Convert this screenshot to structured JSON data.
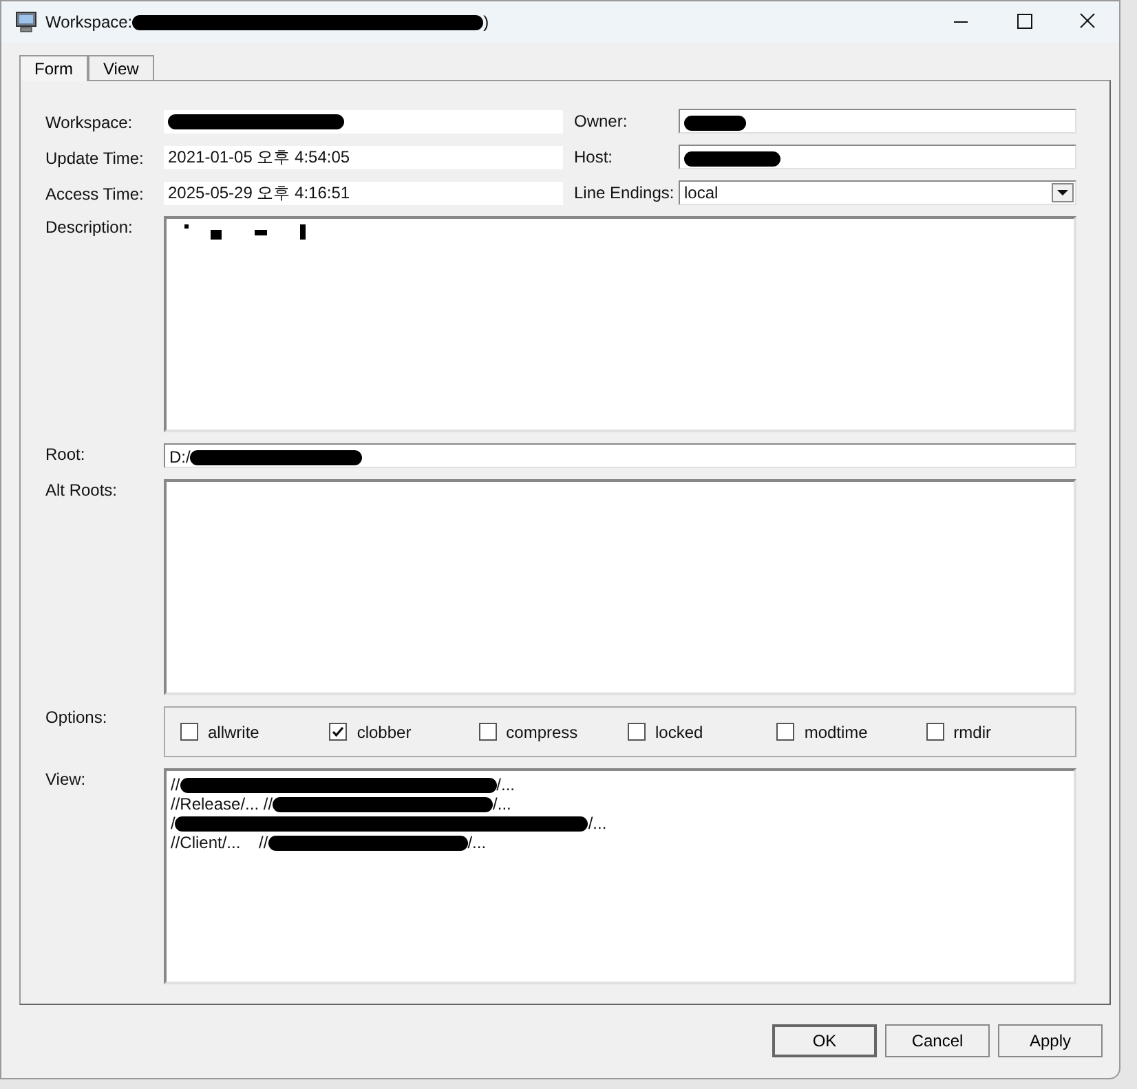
{
  "window": {
    "title": "Workspace:",
    "title_end": ")"
  },
  "tabs": [
    {
      "label": "Form",
      "selected": true
    },
    {
      "label": "View",
      "selected": false
    }
  ],
  "fields": {
    "workspace": {
      "label": "Workspace:"
    },
    "update_time": {
      "label": "Update Time:",
      "value": "2021-01-05 오후 4:54:05"
    },
    "access_time": {
      "label": "Access Time:",
      "value": "2025-05-29 오후 4:16:51"
    },
    "owner": {
      "label": "Owner:"
    },
    "host": {
      "label": "Host:"
    },
    "line_endings": {
      "label": "Line Endings:",
      "value": "local"
    },
    "description": {
      "label": "Description:"
    },
    "root": {
      "label": "Root:",
      "value": "D:/"
    },
    "alt_roots": {
      "label": "Alt Roots:"
    }
  },
  "options": {
    "label": "Options:",
    "items": [
      {
        "label": "allwrite",
        "checked": false
      },
      {
        "label": "clobber",
        "checked": true
      },
      {
        "label": "compress",
        "checked": false
      },
      {
        "label": "locked",
        "checked": false
      },
      {
        "label": "modtime",
        "checked": false
      },
      {
        "label": "rmdir",
        "checked": false
      }
    ]
  },
  "view": {
    "label": "View:",
    "lines": [
      {
        "before": "//",
        "after": "/..."
      },
      {
        "before": "//Release/... //",
        "after": "/..."
      },
      {
        "before": "/",
        "after": "/..."
      },
      {
        "before": "//Client/...    //",
        "after": "/..."
      }
    ]
  },
  "buttons": [
    {
      "label": "OK",
      "default": true
    },
    {
      "label": "Cancel",
      "default": false
    },
    {
      "label": "Apply",
      "default": false
    }
  ]
}
